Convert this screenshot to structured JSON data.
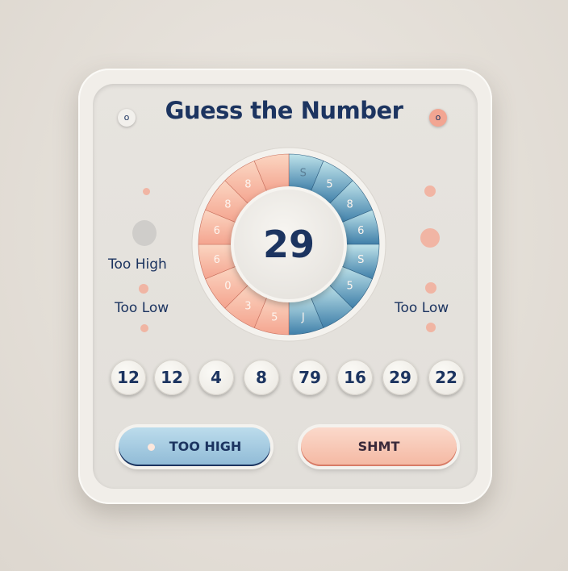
{
  "title": "Guess the Number",
  "corner_icons": {
    "left": {
      "icon": "circle-o-icon",
      "glyph": "o",
      "color": "#f2f0ec"
    },
    "right": {
      "icon": "circle-o-icon",
      "glyph": "o",
      "color": "#f2a592"
    }
  },
  "dial": {
    "current_guess": "29",
    "segment_labels": [
      "S",
      "5",
      "8",
      "6",
      "S",
      "5",
      "",
      "J",
      "5",
      "3",
      "0",
      "6",
      "6",
      "8",
      "8",
      ""
    ],
    "colors": {
      "low": "#f4a48f",
      "low_light": "#fbd6c2",
      "high": "#4f8db5",
      "high_light": "#bfe3ea"
    }
  },
  "side_labels": {
    "left_high": "Too High",
    "left_low": "Too Low",
    "right_low": "Too Low"
  },
  "previous_guesses": [
    "12",
    "12",
    "4",
    "8",
    "79",
    "16",
    "29",
    "22"
  ],
  "buttons": {
    "too_high": "TOO HIGH",
    "hint": "SHMT"
  },
  "colors": {
    "text": "#1c3460",
    "accent_blue": "#8fbad6",
    "accent_salmon": "#f4b8a2"
  }
}
